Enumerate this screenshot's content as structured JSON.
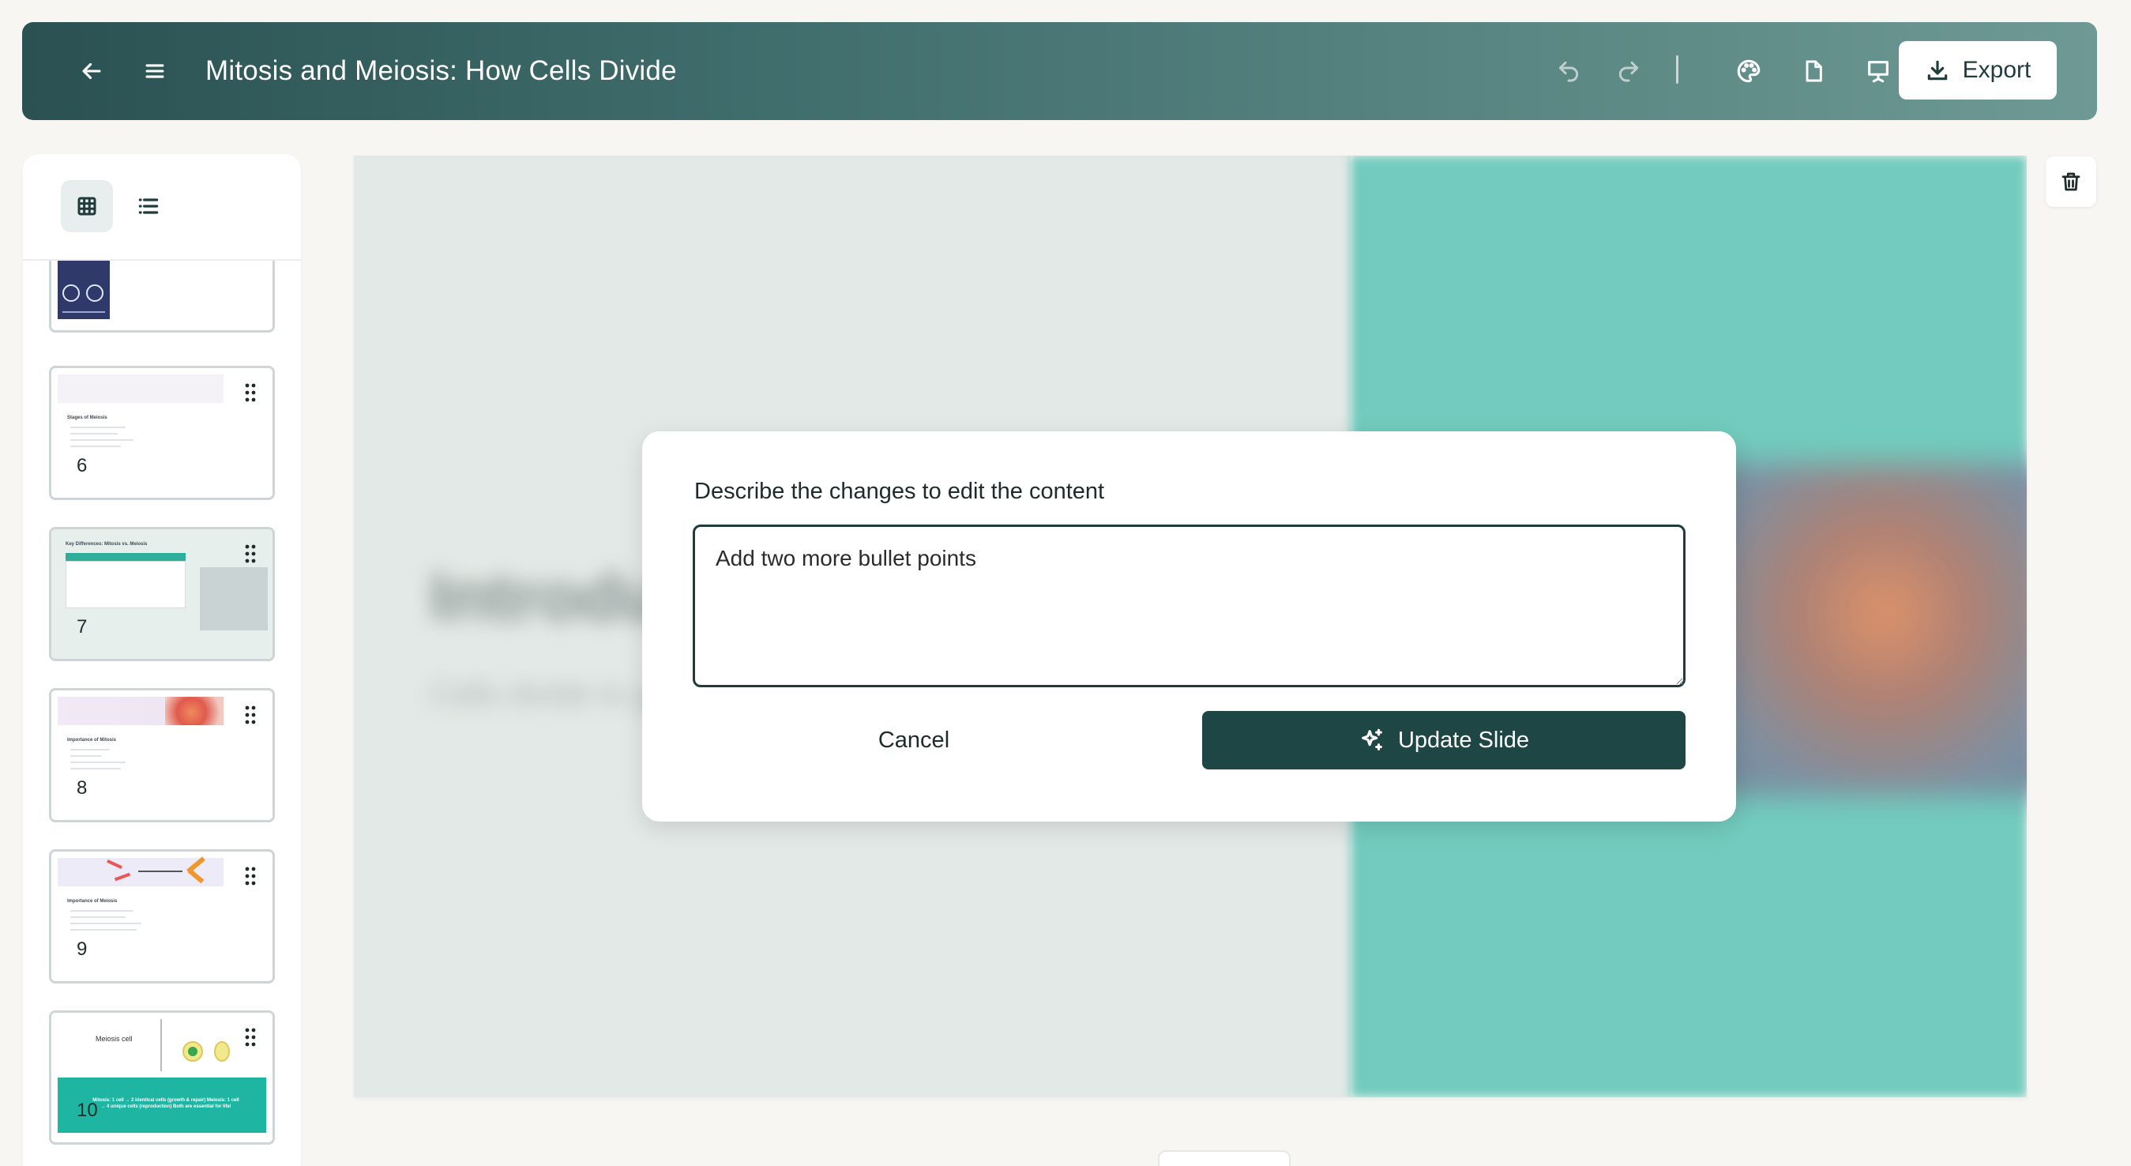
{
  "header": {
    "title": "Mitosis and Meiosis: How Cells Divide",
    "export_label": "Export",
    "icons": [
      "back-arrow-icon",
      "menu-icon",
      "undo-icon",
      "redo-icon",
      "palette-icon",
      "page-icon",
      "present-icon",
      "download-icon"
    ]
  },
  "sidebar": {
    "view_modes": [
      "grid-view",
      "list-view"
    ],
    "active_view": "grid-view",
    "slides": [
      {
        "number": "",
        "title": ""
      },
      {
        "number": "6",
        "title": "Stages of Meiosis"
      },
      {
        "number": "7",
        "title": "Key Differences: Mitosis vs. Meiosis"
      },
      {
        "number": "8",
        "title": "Importance of Mitosis"
      },
      {
        "number": "9",
        "title": "Importance of Meiosis"
      },
      {
        "number": "10",
        "title": "Meiosis cell",
        "caption": "Mitosis: 1 cell → 2 identical cells (growth & repair) Meiosis: 1 cell → 4 unique cells (reproduction) Both are essential for life!"
      }
    ]
  },
  "dialog": {
    "label": "Describe the changes to edit the content",
    "input_value": "Add two more bullet points",
    "cancel_label": "Cancel",
    "update_label": "Update Slide"
  },
  "colors": {
    "header_dark": "#2b5152",
    "accent": "#1e4645",
    "slide_teal": "#72cbbe",
    "slide_light": "#e3e9e6"
  }
}
